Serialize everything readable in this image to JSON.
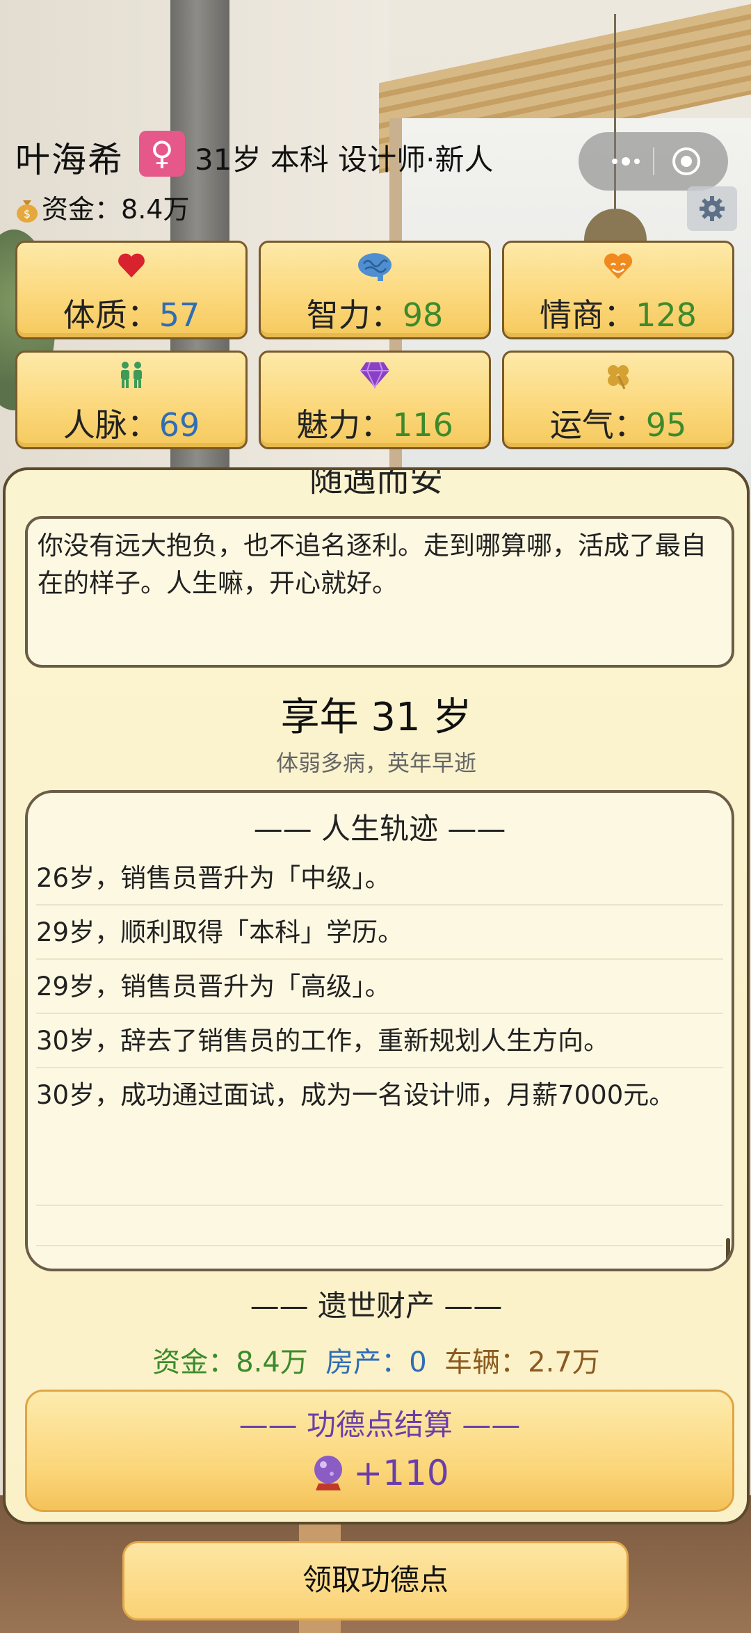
{
  "header": {
    "name": "叶海希",
    "gender_symbol": "♀",
    "info": "31岁 本科 设计师·新人",
    "funds_label": "资金：",
    "funds_value": "8.4万"
  },
  "stats": [
    {
      "label": "体质：",
      "value": "57",
      "icon": "heart-icon"
    },
    {
      "label": "智力：",
      "value": "98",
      "icon": "brain-icon"
    },
    {
      "label": "情商：",
      "value": "128",
      "icon": "smile-heart-icon"
    },
    {
      "label": "人脉：",
      "value": "69",
      "icon": "people-icon"
    },
    {
      "label": "魅力：",
      "value": "116",
      "icon": "diamond-icon"
    },
    {
      "label": "运气：",
      "value": "95",
      "icon": "clover-icon"
    }
  ],
  "result": {
    "partial_title": "随遇而安",
    "description": "你没有远大抱负，也不追名逐利。走到哪算哪，活成了最自在的样子。人生嘛，开心就好。",
    "age_text": "享年 31 岁",
    "death_cause": "体弱多病，英年早逝",
    "track_title": "—— 人生轨迹 ——",
    "track": [
      "26岁，销售员晋升为「中级」。",
      "29岁，顺利取得「本科」学历。",
      "29岁，销售员晋升为「高级」。",
      "30岁，辞去了销售员的工作，重新规划人生方向。",
      "30岁，成功通过面试，成为一名设计师，月薪7000元。"
    ],
    "legacy_title": "—— 遗世财产 ——",
    "legacy": {
      "funds_label": "资金：",
      "funds_value": "8.4万",
      "house_label": "房产：",
      "house_value": "0",
      "car_label": "车辆：",
      "car_value": "2.7万"
    },
    "merit_title": "—— 功德点结算 ——",
    "merit_value": "+110"
  },
  "claim_button": "领取功德点",
  "colors": {
    "stat_value_blue": "#2f6db5",
    "stat_value_green": "#3c8a2c",
    "merit_purple": "#6a3ea8",
    "gender_badge": "#e7588a"
  }
}
